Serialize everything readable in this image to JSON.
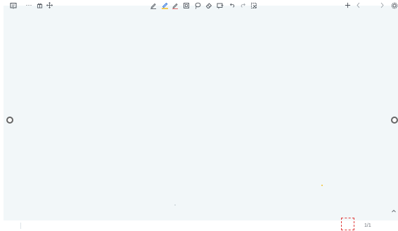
{
  "toolbar": {
    "left": {
      "whiteboard_icon": "whiteboard-icon",
      "more_icon": "more-icon",
      "more_glyph": "···",
      "gift_icon": "gift-icon",
      "move_icon": "move-icon"
    },
    "center": [
      "pen-icon",
      "highlighter-icon",
      "pen-alt-icon",
      "shapes-icon",
      "lasso-icon",
      "eraser-icon",
      "notes-icon",
      "undo-icon",
      "redo-icon",
      "clear-icon"
    ],
    "right": {
      "add_page_icon": "add-page-icon",
      "prev_icon": "chevron-left-icon",
      "page": "1/1",
      "next_icon": "chevron-right-icon",
      "settings_icon": "settings-icon"
    }
  },
  "colors": {
    "canvas": "#f2f7f9",
    "accent_highlight": "#e03b3b",
    "highlighter_active": "#2b6fd6",
    "highlighter_underline": "#f2c230"
  }
}
